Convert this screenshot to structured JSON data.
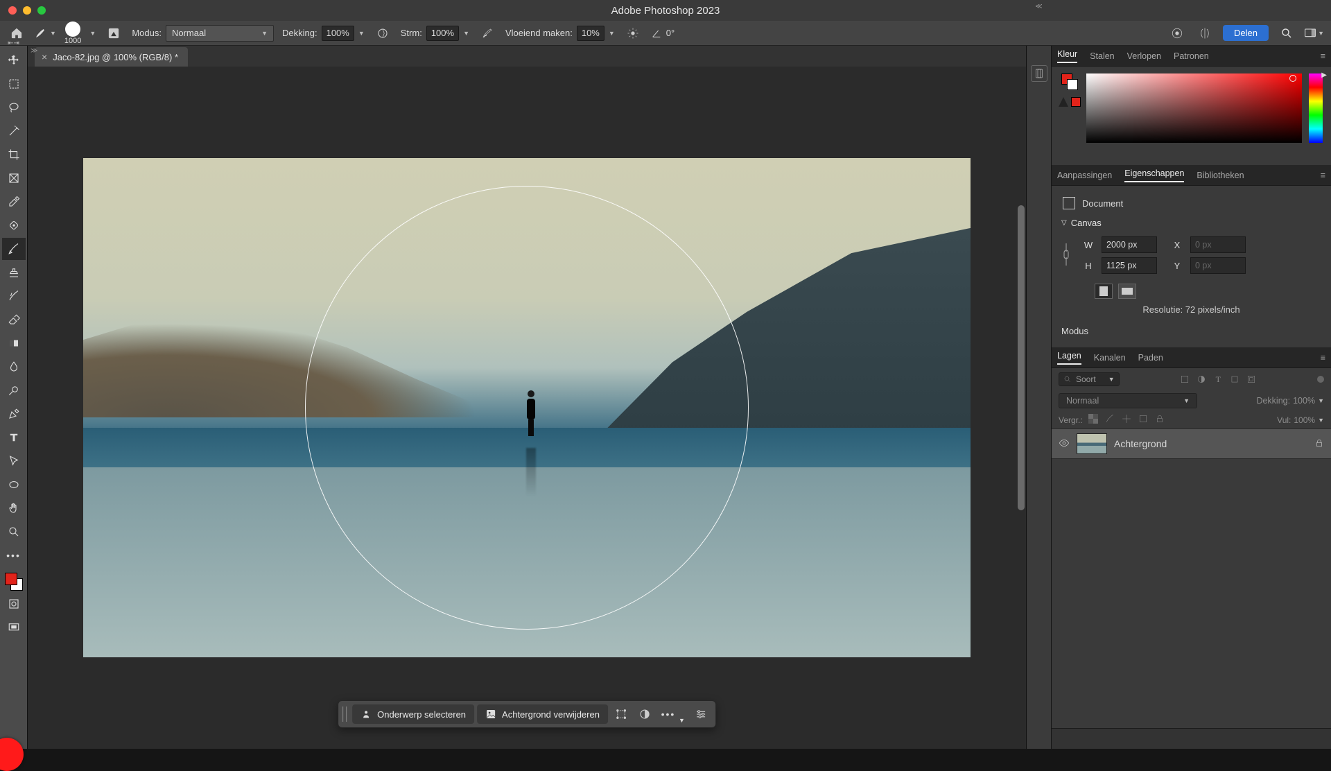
{
  "app_title": "Adobe Photoshop 2023",
  "document_tab": "Jaco-82.jpg @ 100% (RGB/8) *",
  "options": {
    "brush_size": "1000",
    "modus_label": "Modus:",
    "modus_value": "Normaal",
    "dekking_label": "Dekking:",
    "dekking_value": "100%",
    "strm_label": "Strm:",
    "strm_value": "100%",
    "vloeiend_label": "Vloeiend maken:",
    "vloeiend_value": "10%",
    "angle_label": "0°"
  },
  "share_label": "Delen",
  "ctx_bar": {
    "select_subject": "Onderwerp selecteren",
    "remove_bg": "Achtergrond verwijderen"
  },
  "panels": {
    "color_tabs": [
      "Kleur",
      "Stalen",
      "Verlopen",
      "Patronen"
    ],
    "prop_tabs": [
      "Aanpassingen",
      "Eigenschappen",
      "Bibliotheken"
    ],
    "layer_tabs": [
      "Lagen",
      "Kanalen",
      "Paden"
    ]
  },
  "properties": {
    "doc_label": "Document",
    "canvas_label": "Canvas",
    "W": "W",
    "H": "H",
    "X": "X",
    "Y": "Y",
    "w_value": "2000 px",
    "h_value": "1125 px",
    "x_value": "0 px",
    "y_value": "0 px",
    "resolution": "Resolutie: 72 pixels/inch",
    "modus_label": "Modus"
  },
  "layers": {
    "filter_placeholder": "Soort",
    "blend_mode": "Normaal",
    "opacity_label": "Dekking:",
    "opacity_value": "100%",
    "lock_label": "Vergr.:",
    "fill_label": "Vul:",
    "fill_value": "100%",
    "layer_name": "Achtergrond"
  }
}
